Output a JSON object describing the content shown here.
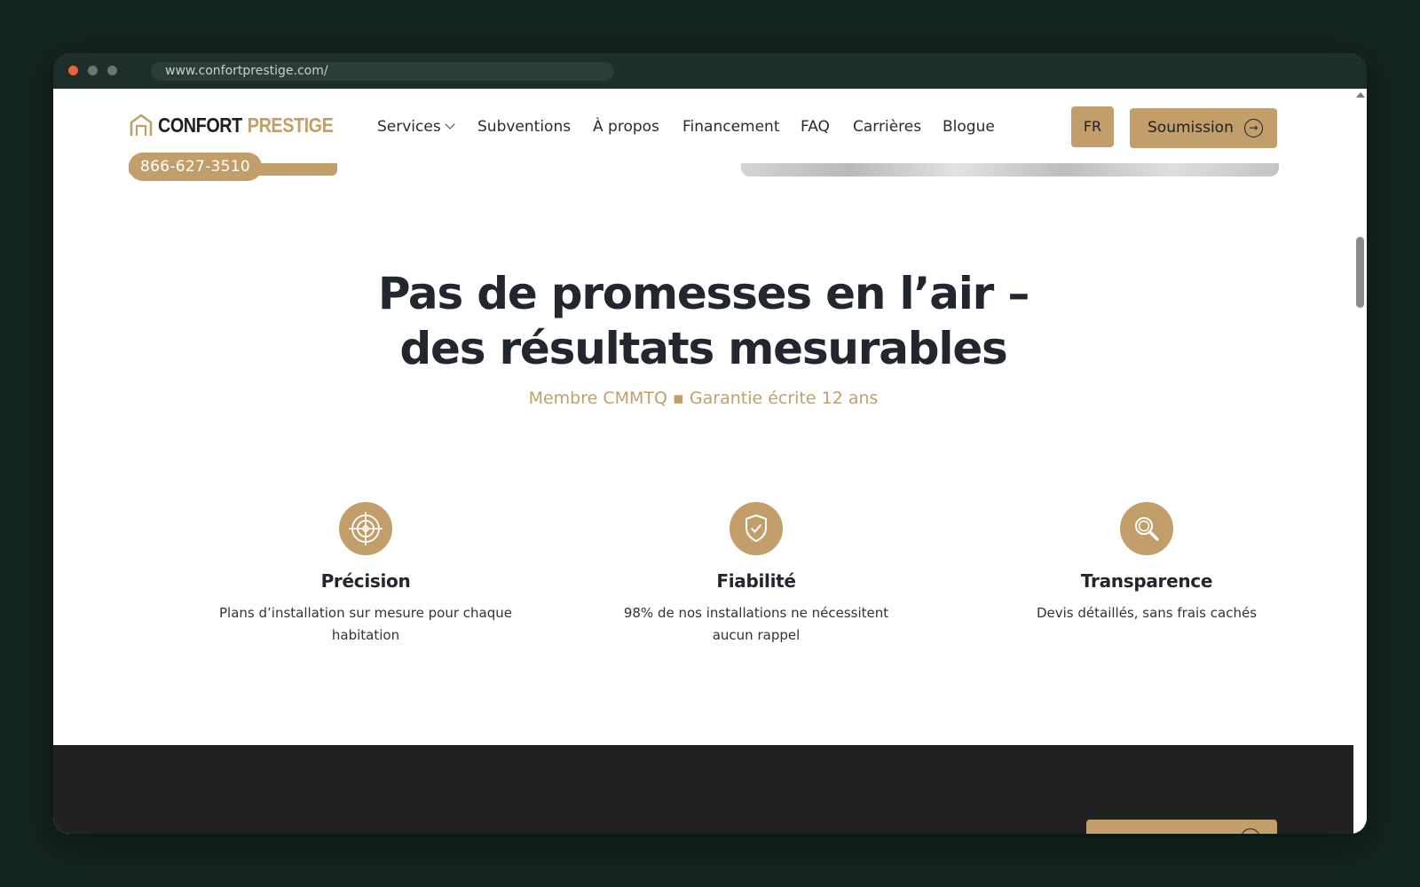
{
  "browser": {
    "url": "www.confortprestige.com/",
    "dots": {
      "close": "#e8633a",
      "min": "#6b7672",
      "max": "#6b7672"
    }
  },
  "brand": {
    "name_part1": "CONFORT",
    "name_part2": "PRESTIGE",
    "phone": "866-627-3510",
    "accent": "#c29f6a",
    "dark": "#22262e"
  },
  "nav": {
    "items": [
      {
        "label": "Services",
        "has_dropdown": true
      },
      {
        "label": "Subventions"
      },
      {
        "label": "À propos"
      },
      {
        "label": "Financement"
      },
      {
        "label": "FAQ"
      },
      {
        "label": "Carrières"
      },
      {
        "label": "Blogue"
      }
    ],
    "lang": "FR",
    "cta": "Soumission"
  },
  "hero": {
    "line1": "Pas de promesses en l’air –",
    "line2": "des résultats mesurables",
    "tagline": "Membre CMMTQ ▪ Garantie écrite 12 ans"
  },
  "features": [
    {
      "icon": "target-icon",
      "title": "Précision",
      "desc": "Plans d’installation sur mesure pour chaque habitation"
    },
    {
      "icon": "shield-check-icon",
      "title": "Fiabilité",
      "desc": "98% de nos installations ne nécessitent aucun rappel"
    },
    {
      "icon": "magnifier-icon",
      "title": "Transparence",
      "desc": "Devis détaillés, sans frais cachés"
    }
  ]
}
